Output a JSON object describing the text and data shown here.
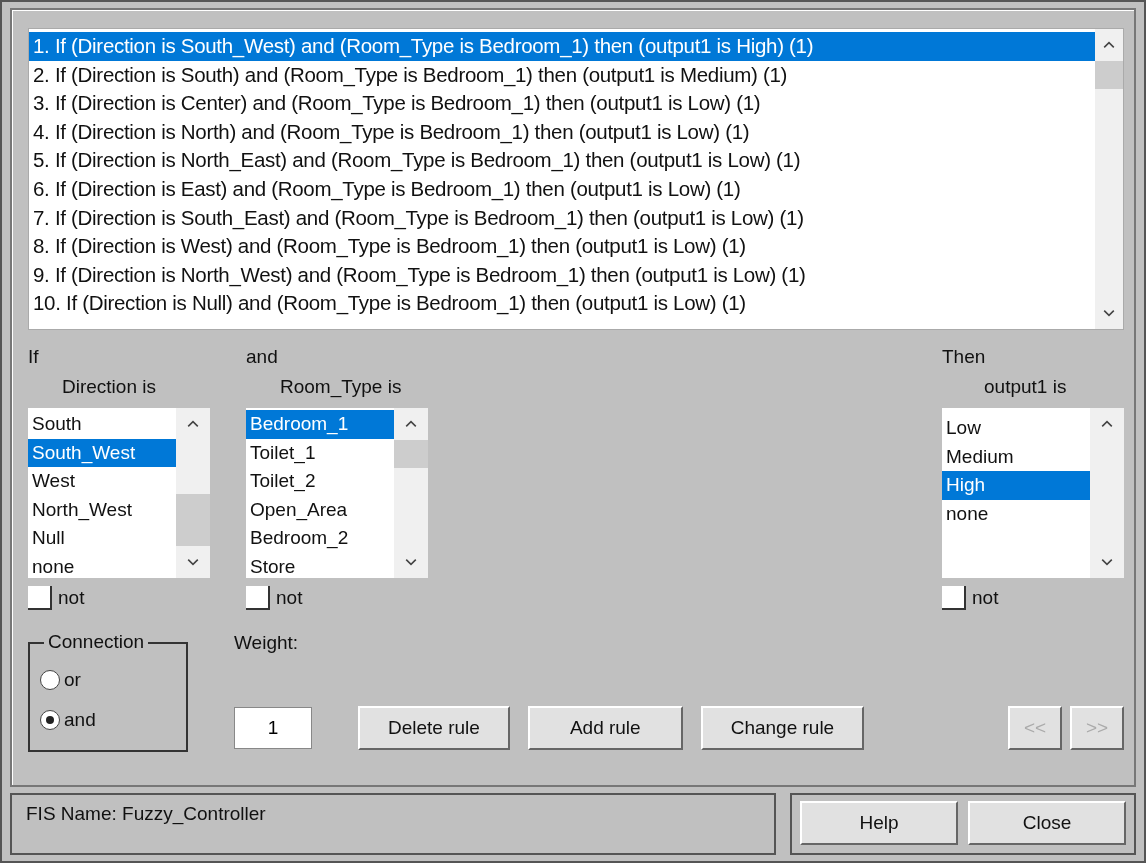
{
  "rules": [
    {
      "text": "1. If (Direction is South_West) and (Room_Type is Bedroom_1) then (output1 is High) (1)",
      "selected": true
    },
    {
      "text": "2. If (Direction is South) and (Room_Type is Bedroom_1) then (output1 is Medium) (1)",
      "selected": false
    },
    {
      "text": "3. If (Direction is Center) and (Room_Type is Bedroom_1) then (output1 is Low) (1)",
      "selected": false
    },
    {
      "text": "4. If (Direction is North) and (Room_Type is Bedroom_1) then (output1 is Low) (1)",
      "selected": false
    },
    {
      "text": "5. If (Direction is North_East) and (Room_Type is Bedroom_1) then (output1 is Low) (1)",
      "selected": false
    },
    {
      "text": "6. If (Direction is East) and (Room_Type is Bedroom_1) then (output1 is Low) (1)",
      "selected": false
    },
    {
      "text": "7. If (Direction is South_East) and (Room_Type is Bedroom_1) then (output1 is Low) (1)",
      "selected": false
    },
    {
      "text": "8. If (Direction is West) and (Room_Type is Bedroom_1) then (output1 is Low) (1)",
      "selected": false
    },
    {
      "text": "9. If (Direction is North_West) and (Room_Type is Bedroom_1) then (output1 is Low) (1)",
      "selected": false
    },
    {
      "text": "10. If (Direction is Null) and (Room_Type is Bedroom_1) then (output1 is Low) (1)",
      "selected": false
    }
  ],
  "inputs": [
    {
      "prefix": "If",
      "label": "Direction is",
      "items": [
        {
          "text": "South",
          "selected": false
        },
        {
          "text": "South_West",
          "selected": true
        },
        {
          "text": "West",
          "selected": false
        },
        {
          "text": "North_West",
          "selected": false
        },
        {
          "text": "Null",
          "selected": false
        },
        {
          "text": "none",
          "selected": false
        }
      ],
      "not_label": "not",
      "not_checked": false
    },
    {
      "prefix": "and",
      "label": "Room_Type is",
      "items": [
        {
          "text": "Bedroom_1",
          "selected": true
        },
        {
          "text": "Toilet_1",
          "selected": false
        },
        {
          "text": "Toilet_2",
          "selected": false
        },
        {
          "text": "Open_Area",
          "selected": false
        },
        {
          "text": "Bedroom_2",
          "selected": false
        },
        {
          "text": "Store",
          "selected": false
        }
      ],
      "not_label": "not",
      "not_checked": false
    }
  ],
  "output": {
    "prefix": "Then",
    "label": "output1 is",
    "items": [
      {
        "text": "Low",
        "selected": false
      },
      {
        "text": "Medium",
        "selected": false
      },
      {
        "text": "High",
        "selected": true
      },
      {
        "text": "none",
        "selected": false
      }
    ],
    "not_label": "not",
    "not_checked": false
  },
  "connection": {
    "title": "Connection",
    "options": [
      {
        "label": "or",
        "selected": false
      },
      {
        "label": "and",
        "selected": true
      }
    ]
  },
  "weight": {
    "label": "Weight:",
    "value": "1"
  },
  "rule_buttons": [
    "Delete rule",
    "Add rule",
    "Change rule"
  ],
  "nav_buttons": [
    {
      "label": "<<",
      "disabled": true
    },
    {
      "label": ">>",
      "disabled": true
    }
  ],
  "status": "FIS Name: Fuzzy_Controller",
  "footer_buttons": [
    "Help",
    "Close"
  ]
}
